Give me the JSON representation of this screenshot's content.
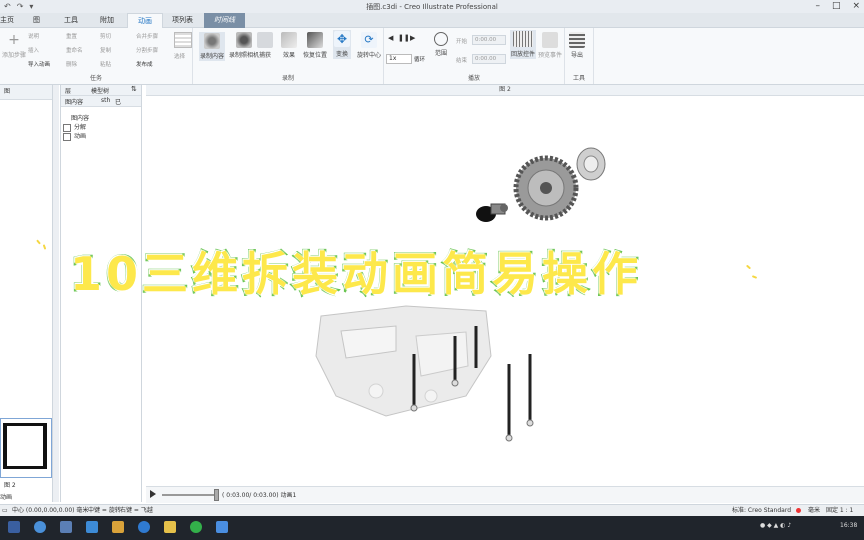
{
  "titlebar": {
    "title": "插图.c3di - Creo Illustrate Professional",
    "quick_access": [
      "↶",
      "↷",
      "▾"
    ]
  },
  "tabs": [
    "主页",
    "图",
    "工具",
    "附加",
    "动画",
    "项列表",
    "时间线"
  ],
  "ribbon": {
    "task_group": {
      "label": "任务",
      "add_step": "添加步骤",
      "items": [
        "说明",
        "插入",
        "导入动画",
        "重置",
        "重命名",
        "删除",
        "剪切",
        "复制",
        "粘贴",
        "合并步骤",
        "分割步骤",
        "发布成",
        "选择"
      ]
    },
    "record_group": {
      "label": "录制",
      "buttons": [
        "录制内容",
        "录制照相机",
        "捕获",
        "效果",
        "恢复位置",
        "变换",
        "旋转中心"
      ]
    },
    "play_group": {
      "label": "播放",
      "speed": "1x",
      "loop": "循环",
      "range": "范围",
      "start_label": "开始",
      "end_label": "结束",
      "start_value": "0:00.00",
      "end_value": "0:00.00",
      "play_label": "回放控件",
      "preview_label": "预览事件"
    },
    "tools_group": {
      "label": "工具",
      "export": "导出"
    }
  },
  "viewport": {
    "header": "图 2"
  },
  "left_panel": {
    "tab": "图",
    "thumb_label": "图 2",
    "bottom_label": "动画"
  },
  "structure_panel": {
    "tabs_row1": [
      "层",
      "模型树"
    ],
    "tabs_row2": [
      "图内容",
      "sth",
      "已"
    ],
    "tree_header": "图内容",
    "tree_items": [
      "分解",
      "动画"
    ]
  },
  "timeline": {
    "time_text": "( 0:03.00/ 0:03.00) 动画1"
  },
  "statusbar": {
    "center": "中心 (0.00,0.00,0.00) 毫米",
    "middle_mouse": "中键 = 旋转",
    "right_mouse": "右键 = 飞越",
    "standard": "标准: Creo Standard",
    "unit": "毫米",
    "fixed": "固定 1 : 1"
  },
  "overlay": {
    "text": "10三维拆装动画简易操作"
  },
  "taskbar": {
    "time": "16:38"
  },
  "colors": {
    "overlay_fill": "#fde84b",
    "overlay_stroke": "#5fc045",
    "accent": "#2477c4"
  }
}
